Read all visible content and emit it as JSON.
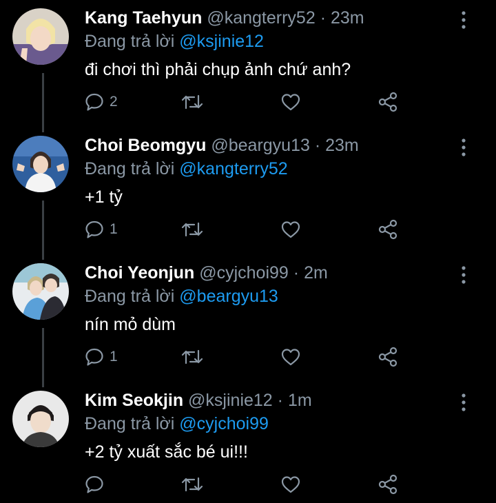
{
  "tweets": [
    {
      "name": "Kang Taehyun",
      "handle": "@kangterry52",
      "dot": "·",
      "time": "23m",
      "reply_prefix": "Đang trả lời",
      "reply_to": "@ksjinie12",
      "text": "đi chơi thì phải chụp ảnh chứ anh?",
      "reply_count": "2"
    },
    {
      "name": "Choi Beomgyu",
      "handle": "@beargyu13",
      "dot": "·",
      "time": "23m",
      "reply_prefix": "Đang trả lời",
      "reply_to": "@kangterry52",
      "text": "+1 tỷ",
      "reply_count": "1"
    },
    {
      "name": "Choi Yeonjun",
      "handle": "@cyjchoi99",
      "dot": "·",
      "time": "2m",
      "reply_prefix": "Đang trả lời",
      "reply_to": "@beargyu13",
      "text": "nín mỏ dùm",
      "reply_count": "1"
    },
    {
      "name": "Kim Seokjin",
      "handle": "@ksjinie12",
      "dot": "·",
      "time": "1m",
      "reply_prefix": "Đang trả lời",
      "reply_to": "@cyjchoi99",
      "text": "+2 tỷ xuất sắc bé ui!!!",
      "reply_count": ""
    }
  ],
  "colors": {
    "background": "#000000",
    "secondary_text": "#8b98a5",
    "link": "#1d9bf0",
    "thread_line": "#3a3f44"
  },
  "icons": [
    "comment-icon",
    "retweet-icon",
    "like-icon",
    "share-icon",
    "more-options-icon"
  ]
}
